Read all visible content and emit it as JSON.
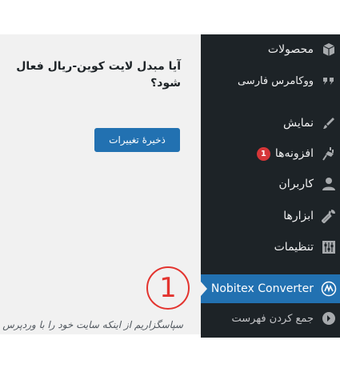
{
  "main": {
    "question": "آیا مبدل لایت کوین-ریال فعال شود؟",
    "save_button": "ذخیرهٔ تغییرات",
    "footer_text": "سپاسگزاریم از اینکه سایت خود را با وردپرس"
  },
  "sidebar": {
    "products": "محصولات",
    "woocommerce": "ووکامرس فارسی",
    "appearance": "نمایش",
    "plugins": "افزونه‌ها",
    "plugins_badge": "1",
    "users": "کاربران",
    "tools": "ابزارها",
    "settings": "تنظیمات",
    "active_item": "Nobitex Converter",
    "collapse": "جمع کردن فهرست"
  },
  "annotation": {
    "number": "1"
  },
  "colors": {
    "sidebar_bg": "#1d2327",
    "active_bg": "#2271b1",
    "content_bg": "#f1f1f1",
    "annotation": "#e3342f",
    "badge": "#d63638"
  }
}
